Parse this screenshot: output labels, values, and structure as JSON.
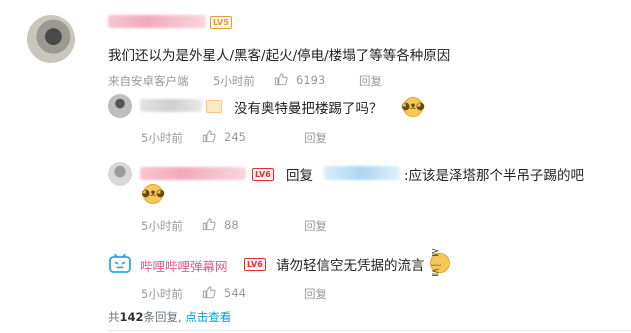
{
  "comment": {
    "level": "LV5",
    "text": "我们还以为是外星人/黑客/起火/停电/楼塌了等等各种原因",
    "source": "来自安卓客户端",
    "time": "5小时前",
    "likes": "6193",
    "reply_label": "回复"
  },
  "replies": [
    {
      "level": "",
      "text": "没有奥特曼把楼踢了吗？",
      "time": "5小时前",
      "likes": "245",
      "reply_label": "回复",
      "emoji": "doge"
    },
    {
      "level": "LV6",
      "reply_prefix": "回复",
      "text": ":应该是泽塔那个半吊子踢的吧",
      "time": "5小时前",
      "likes": "88",
      "reply_label": "回复",
      "emoji": "doge"
    },
    {
      "username": "哔哩哔哩弹幕网",
      "level": "LV6",
      "text": "请勿轻信空无凭据的流言",
      "time": "5小时前",
      "likes": "544",
      "reply_label": "回复",
      "emoji": "sweat"
    }
  ],
  "footer": {
    "total_prefix": "共",
    "total_count": "142",
    "total_suffix": "条回复,",
    "view_link": "点击查看"
  },
  "colors": {
    "link": "#00a1d6",
    "lv5": "#e49a36",
    "lv6": "#e3312d",
    "bili_pink": "#e05a8c",
    "meta_grey": "#999999"
  }
}
